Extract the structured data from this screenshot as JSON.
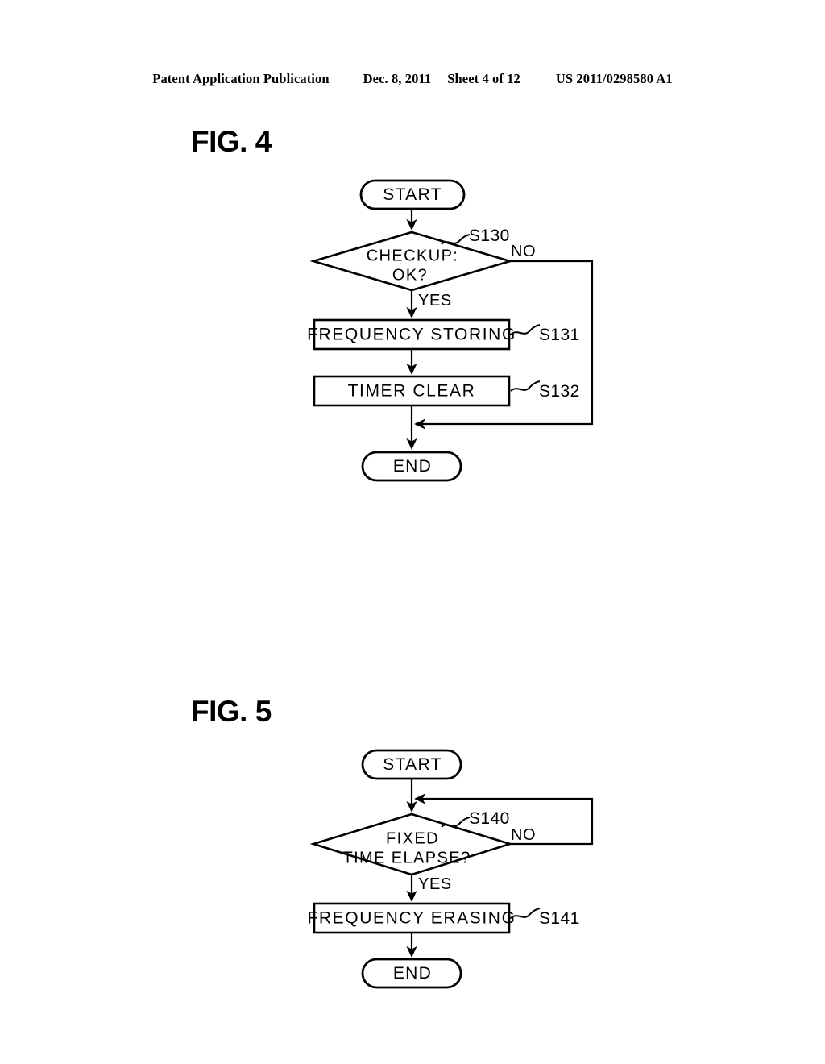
{
  "header": {
    "publication": "Patent Application Publication",
    "date": "Dec. 8, 2011",
    "sheet": "Sheet 4 of 12",
    "patent_number": "US 2011/0298580 A1"
  },
  "figures": [
    {
      "title": "FIG. 4",
      "nodes": {
        "start": "START",
        "decision": {
          "line1": "CHECKUP:",
          "line2": "OK?",
          "step": "S130"
        },
        "process1": {
          "text": "FREQUENCY STORING",
          "step": "S131"
        },
        "process2": {
          "text": "TIMER CLEAR",
          "step": "S132"
        },
        "end": "END"
      },
      "branches": {
        "no": "NO",
        "yes": "YES"
      }
    },
    {
      "title": "FIG. 5",
      "nodes": {
        "start": "START",
        "decision": {
          "line1": "FIXED",
          "line2": "TIME ELAPSE?",
          "step": "S140"
        },
        "process1": {
          "text": "FREQUENCY ERASING",
          "step": "S141"
        },
        "end": "END"
      },
      "branches": {
        "no": "NO",
        "yes": "YES"
      }
    }
  ],
  "colors": {
    "ink": "#000000",
    "paper": "#ffffff"
  }
}
